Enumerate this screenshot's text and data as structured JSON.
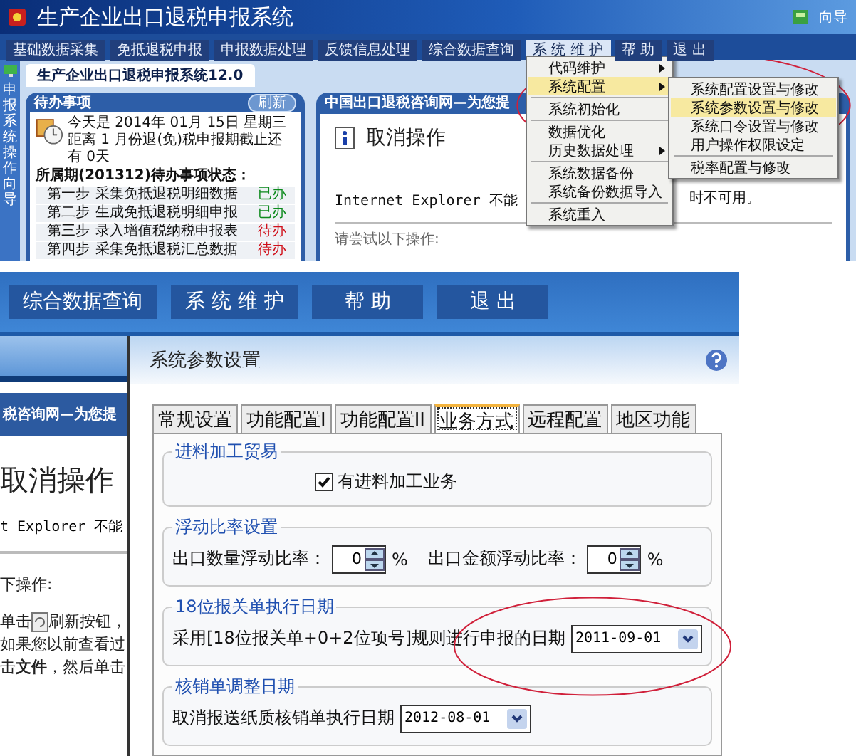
{
  "top_screen": {
    "title": "生产企业出口退税申报系统",
    "guide": "向导",
    "menu": [
      {
        "label": "基础数据采集",
        "selected": false
      },
      {
        "label": "免抵退税申报",
        "selected": false
      },
      {
        "label": "申报数据处理",
        "selected": false
      },
      {
        "label": "反馈信息处理",
        "selected": false
      },
      {
        "label": "综合数据查询",
        "selected": false
      },
      {
        "label": "系 统 维 护",
        "selected": true
      },
      {
        "label": "帮 助",
        "selected": false
      },
      {
        "label": "退 出",
        "selected": false
      }
    ],
    "doc_tab": "生产企业出口退税申报系统12.0",
    "side_strip": "申报系统操作向导",
    "todo_panel": {
      "title": "待办事项",
      "refresh": "刷新",
      "date_line": "今天是 2014年 01月 15日 星期三",
      "deadline_line": "距离 1 月份退(免)税申报期截止还有 0天",
      "period_line": "所属期(201312)待办事项状态：",
      "steps": [
        {
          "step": "第一步",
          "task": "采集免抵退税明细数据",
          "status": "已办",
          "done": true
        },
        {
          "step": "第二步",
          "task": "生成免抵退税明细申报",
          "status": "已办",
          "done": true
        },
        {
          "step": "第三步",
          "task": "录入增值税纳税申报表",
          "status": "待办",
          "done": false
        },
        {
          "step": "第四步",
          "task": "采集免抵退税汇总数据",
          "status": "待办",
          "done": false
        }
      ]
    },
    "news_panel": {
      "title": "中国出口退税咨询网—为您提",
      "heading": "取消操作",
      "message": "Internet Explorer 不能",
      "message_tail": "时不可用。",
      "hint": "请尝试以下操作:"
    },
    "dropdown": [
      {
        "kind": "item",
        "label": "代码维护",
        "submenu": true,
        "selected": false
      },
      {
        "kind": "item",
        "label": "系统配置",
        "submenu": true,
        "selected": true
      },
      {
        "kind": "separator"
      },
      {
        "kind": "item",
        "label": "系统初始化",
        "submenu": false,
        "selected": false
      },
      {
        "kind": "separator"
      },
      {
        "kind": "item",
        "label": "数据优化",
        "submenu": false,
        "selected": false
      },
      {
        "kind": "item",
        "label": "历史数据处理",
        "submenu": true,
        "selected": false
      },
      {
        "kind": "separator"
      },
      {
        "kind": "item",
        "label": "系统数据备份",
        "submenu": false,
        "selected": false
      },
      {
        "kind": "item",
        "label": "系统备份数据导入",
        "submenu": false,
        "selected": false
      },
      {
        "kind": "separator"
      },
      {
        "kind": "item",
        "label": "系统重入",
        "submenu": false,
        "selected": false
      }
    ],
    "submenu": [
      {
        "kind": "item",
        "label": "系统配置设置与修改",
        "selected": false
      },
      {
        "kind": "item",
        "label": "系统参数设置与修改",
        "selected": true
      },
      {
        "kind": "item",
        "label": "系统口令设置与修改",
        "selected": false
      },
      {
        "kind": "item",
        "label": "用户操作权限设定",
        "selected": false
      },
      {
        "kind": "separator"
      },
      {
        "kind": "item",
        "label": "税率配置与修改",
        "selected": false
      }
    ]
  },
  "bottom_screen": {
    "menu": [
      "综合数据查询",
      "系 统 维 护",
      "帮 助",
      "退 出"
    ],
    "behind": {
      "header": "税咨询网—为您提",
      "heading": "取消操作",
      "message": "t Explorer 不能",
      "hint": "下操作:",
      "refresh_before": "单击",
      "refresh_after": "刷新按钮，",
      "line_2": "如果您以前查看过",
      "line_3": "击**文件**，然后单击"
    },
    "dialog": {
      "title": "系统参数设置",
      "tabs": [
        {
          "label": "常规设置",
          "selected": false
        },
        {
          "label": "功能配置I",
          "selected": false
        },
        {
          "label": "功能配置II",
          "selected": false
        },
        {
          "label": "业务方式",
          "selected": true
        },
        {
          "label": "远程配置",
          "selected": false
        },
        {
          "label": "地区功能",
          "selected": false
        }
      ],
      "groups": [
        {
          "title": "进料加工贸易",
          "rows": [
            {
              "kind": "checkbox",
              "label": "有进料加工业务",
              "checked": true
            }
          ]
        },
        {
          "title": "浮动比率设置",
          "rows": [
            {
              "kind": "spinners",
              "fields": [
                {
                  "label": "出口数量浮动比率：",
                  "value": "0",
                  "unit": "%"
                },
                {
                  "label": "出口金额浮动比率：",
                  "value": "0",
                  "unit": "%"
                }
              ]
            }
          ]
        },
        {
          "title": "18位报关单执行日期",
          "rows": [
            {
              "kind": "date",
              "label": "采用[18位报关单+0+2位项号]规则进行申报的日期",
              "value": "2011-09-01"
            }
          ]
        },
        {
          "title": "核销单调整日期",
          "rows": [
            {
              "kind": "date",
              "label": "取消报送纸质核销单执行日期",
              "value": "2012-08-01"
            }
          ]
        }
      ]
    }
  }
}
